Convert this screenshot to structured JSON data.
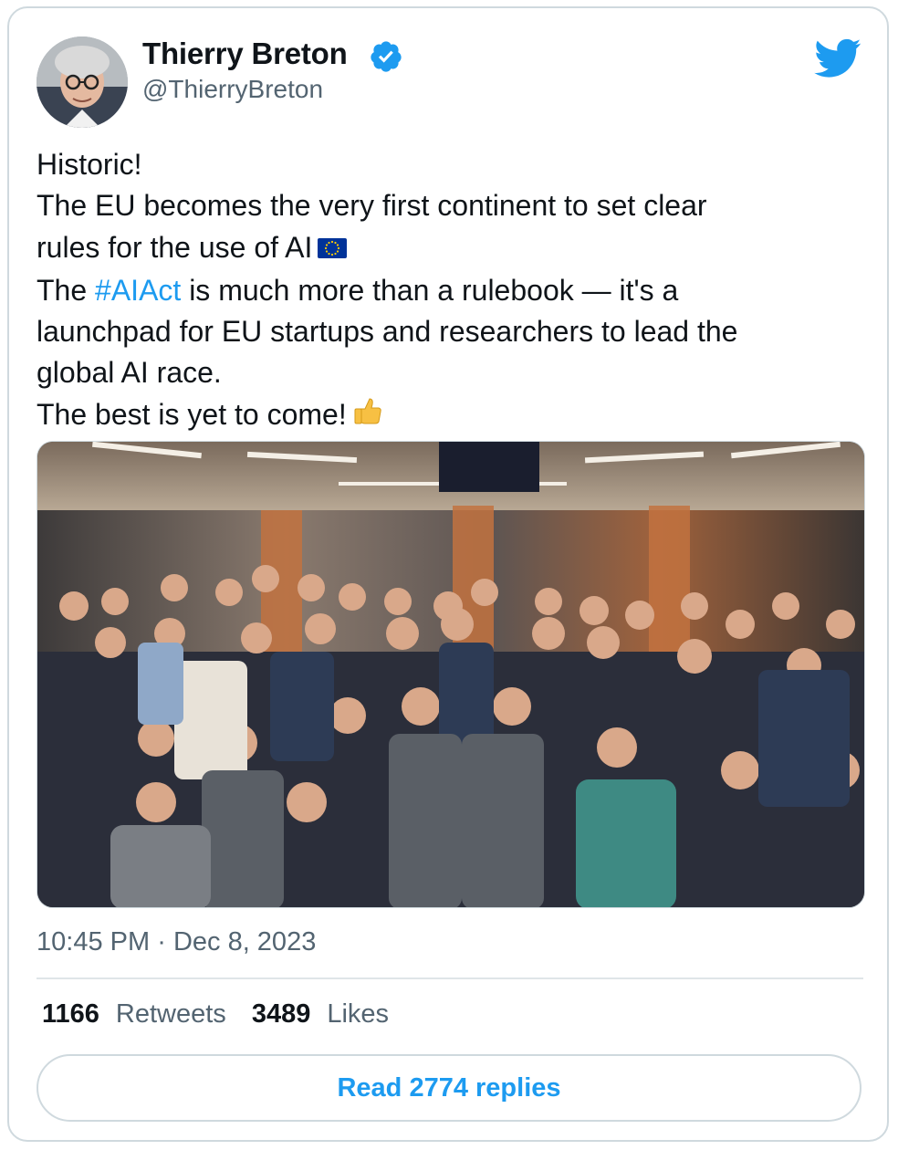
{
  "author": {
    "display_name": "Thierry Breton",
    "handle": "@ThierryBreton",
    "verified": true
  },
  "tweet": {
    "lines": [
      "Historic!",
      "The EU becomes the very first continent to set clear",
      "rules for the use of AI"
    ],
    "line4_prefix": "The ",
    "hashtag": "#AIAct",
    "line4_suffix": " is much more than a rulebook — it's a",
    "lines_after": [
      "launchpad for EU startups and researchers to lead the",
      "global AI race."
    ],
    "last_line": "The best is yet to come!",
    "emojis": [
      "eu-flag-emoji",
      "thumbs-up-emoji"
    ]
  },
  "timestamp": {
    "time": "10:45 PM",
    "separator": "·",
    "date": "Dec 8, 2023"
  },
  "stats": {
    "retweets_count": "1166",
    "retweets_label": "Retweets",
    "likes_count": "3489",
    "likes_label": "Likes"
  },
  "replies_button": {
    "label": "Read 2774 replies"
  },
  "colors": {
    "link_blue": "#1d9bf0",
    "verified_blue": "#1d9bf0",
    "secondary_text": "#536471",
    "border": "#cfd9de"
  },
  "icons": [
    "verified-badge-icon",
    "twitter-bird-icon"
  ]
}
